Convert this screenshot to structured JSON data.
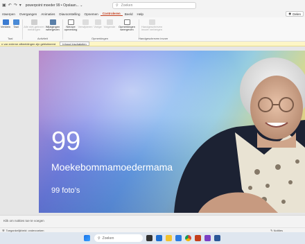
{
  "titlebar": {
    "doc_title": "powerpoint moeder 99 • Opslaan... ⌄",
    "search_placeholder": "Zoeken"
  },
  "menu": {
    "tabs": [
      "ntwerpen",
      "Overgangen",
      "Animaties",
      "Diavoorstelling",
      "Opnemen",
      "Controleren",
      "Beeld",
      "Help"
    ],
    "active_index": 5,
    "share_label": "Delen"
  },
  "ribbon": {
    "buttons": [
      {
        "label": "Verklein",
        "enabled": true
      },
      {
        "label": "Taal",
        "enabled": true
      },
      {
        "label": "Alle niet-gelezen meldingen",
        "enabled": false
      },
      {
        "label": "Wijzigingen weergeven",
        "enabled": true
      },
      {
        "label": "Nieuwe opmerking",
        "enabled": true
      },
      {
        "label": "Verwijderen",
        "enabled": false
      },
      {
        "label": "Vorige",
        "enabled": false
      },
      {
        "label": "Volgende",
        "enabled": false
      },
      {
        "label": "Opmerkingen weergeven",
        "enabled": true
      },
      {
        "label": "Handgeschreven invoer verbergen",
        "enabled": false
      }
    ],
    "groups": [
      "Taal",
      "Activiteit",
      "Opmerkingen",
      "Handgeschreven invoer"
    ]
  },
  "infobar": {
    "message": "n van externe afbeeldingen zijn geblokkeerd",
    "button_label": "Inhoud inschakelen"
  },
  "slide": {
    "number": "99",
    "title": "Moekebommamoedermama",
    "subtitle": "99 foto’s"
  },
  "notes": {
    "placeholder": "Klik om notities toe te voegen"
  },
  "status": {
    "accessibility": "Toegankelijkheid: onderzoeken",
    "notes_label": "Notities"
  },
  "taskbar": {
    "search_placeholder": "Zoeken"
  }
}
